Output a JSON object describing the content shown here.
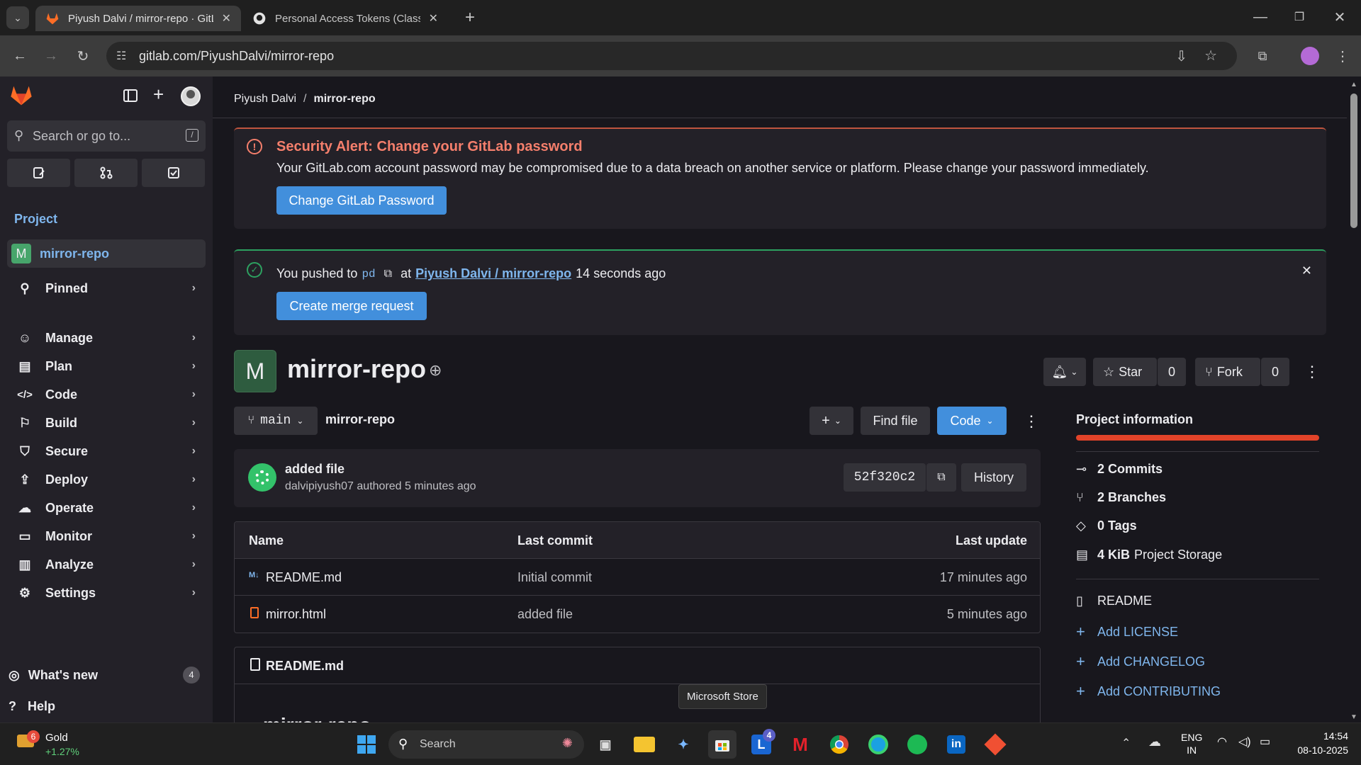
{
  "browser": {
    "tabs": [
      {
        "title": "Piyush Dalvi / mirror-repo · GitLab",
        "active": true
      },
      {
        "title": "Personal Access Tokens (Classic)",
        "active": false
      }
    ],
    "url": "gitlab.com/PiyushDalvi/mirror-repo"
  },
  "sidebar": {
    "search_placeholder": "Search or go to...",
    "search_shortcut": "/",
    "section_title": "Project",
    "project_item": {
      "avatar": "M",
      "label": "mirror-repo"
    },
    "pinned": "Pinned",
    "items": [
      {
        "label": "Manage",
        "icon": "users-icon"
      },
      {
        "label": "Plan",
        "icon": "calendar-icon"
      },
      {
        "label": "Code",
        "icon": "code-icon"
      },
      {
        "label": "Build",
        "icon": "rocket-icon"
      },
      {
        "label": "Secure",
        "icon": "shield-icon"
      },
      {
        "label": "Deploy",
        "icon": "deploy-icon"
      },
      {
        "label": "Operate",
        "icon": "cloud-gear-icon"
      },
      {
        "label": "Monitor",
        "icon": "monitor-icon"
      },
      {
        "label": "Analyze",
        "icon": "chart-icon"
      },
      {
        "label": "Settings",
        "icon": "settings-icon"
      }
    ],
    "whats_new": "What's new",
    "whats_new_count": "4",
    "help": "Help"
  },
  "breadcrumb": {
    "parent": "Piyush Dalvi",
    "separator": "/",
    "current": "mirror-repo"
  },
  "alert": {
    "title": "Security Alert: Change your GitLab password",
    "body": "Your GitLab.com account password may be compromised due to a data breach on another service or platform. Please change your password immediately.",
    "button": "Change GitLab Password"
  },
  "push_notice": {
    "prefix": "You pushed to",
    "branch": "pd",
    "at": "at",
    "project_link": "Piyush Dalvi / mirror-repo",
    "time": "14 seconds ago",
    "button": "Create merge request"
  },
  "project": {
    "avatar": "M",
    "name": "mirror-repo",
    "star_label": "Star",
    "star_count": "0",
    "fork_label": "Fork",
    "fork_count": "0"
  },
  "repo_bar": {
    "branch": "main",
    "path": "mirror-repo",
    "find_file": "Find file",
    "code": "Code"
  },
  "last_commit": {
    "message": "added file",
    "author_line": "dalvipiyush07 authored 5 minutes ago",
    "sha": "52f320c2",
    "history": "History"
  },
  "file_table": {
    "headers": [
      "Name",
      "Last commit",
      "Last update"
    ],
    "rows": [
      {
        "name": "README.md",
        "commit": "Initial commit",
        "updated": "17 minutes ago"
      },
      {
        "name": "mirror.html",
        "commit": "added file",
        "updated": "5 minutes ago"
      }
    ]
  },
  "readme_panel": {
    "title": "README.md",
    "heading": "mirror-repo"
  },
  "project_info": {
    "title": "Project information",
    "commits": "2 Commits",
    "branches": "2 Branches",
    "tags": "0 Tags",
    "storage_bold": "4 KiB",
    "storage_rest": "Project Storage",
    "readme": "README",
    "add_license": "Add LICENSE",
    "add_changelog": "Add CHANGELOG",
    "add_contributing": "Add CONTRIBUTING"
  },
  "tooltip": "Microsoft Store",
  "taskbar": {
    "weather_badge": "6",
    "weather_title": "Gold",
    "weather_sub": "+1.27%",
    "search": "Search",
    "lang1": "ENG",
    "lang2": "IN",
    "time": "14:54",
    "date": "08-10-2025",
    "outlook_badge": "4"
  },
  "colors": {
    "accent_blue": "#428fdc",
    "alert_red": "#f57f6c",
    "success_green": "#2da160",
    "orange": "#fc6d26"
  }
}
